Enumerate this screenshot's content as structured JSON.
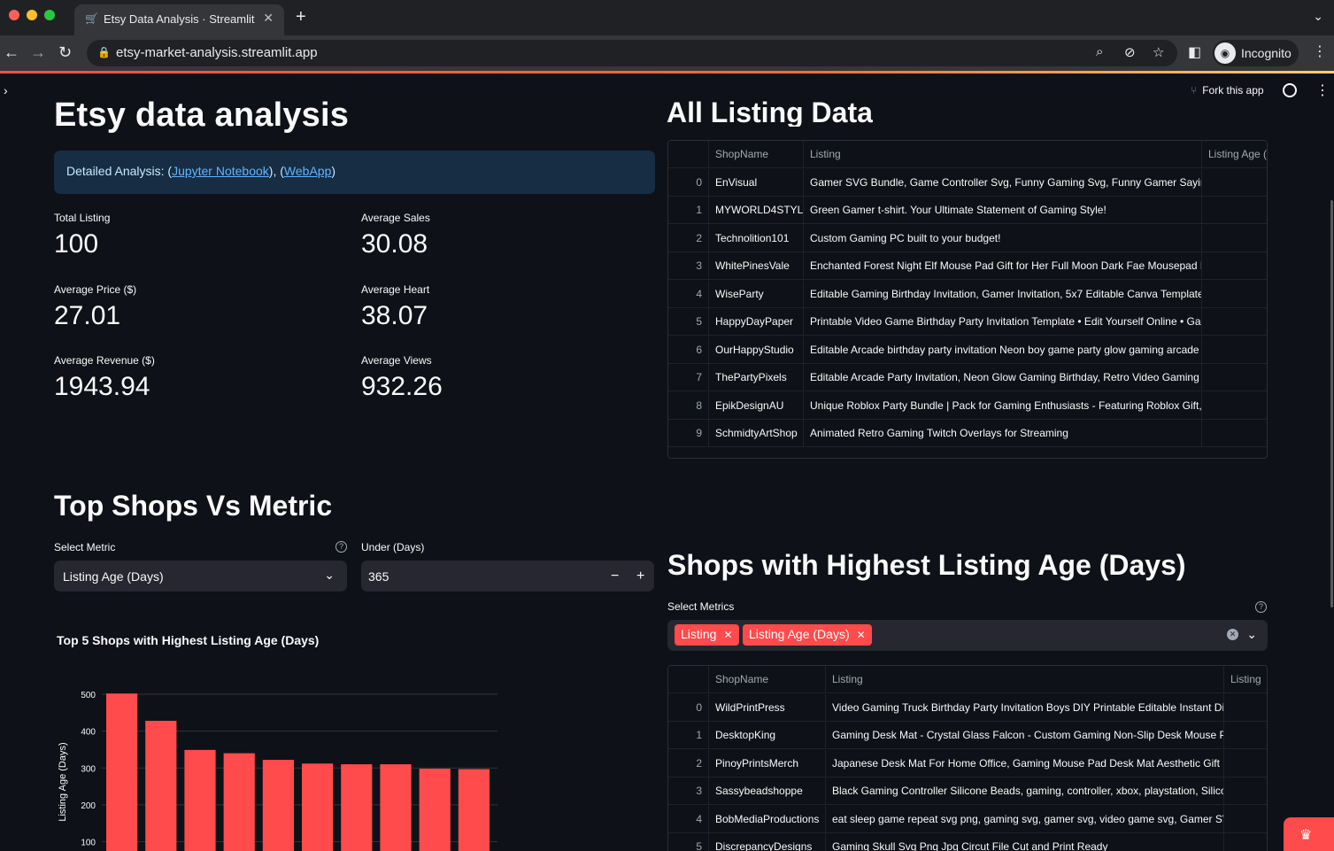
{
  "browser": {
    "tab_title": "Etsy Data Analysis · Streamlit",
    "url": "etsy-market-analysis.streamlit.app",
    "profile_label": "Incognito"
  },
  "header": {
    "fork_label": "Fork this app"
  },
  "page": {
    "title": "Etsy data analysis",
    "info": {
      "prefix": "Detailed Analysis: (",
      "link1": "Jupyter Notebook",
      "middle": "), (",
      "link2": "WebApp",
      "suffix": ")"
    }
  },
  "metrics": [
    {
      "label": "Total Listing",
      "value": "100"
    },
    {
      "label": "Average Sales",
      "value": "30.08"
    },
    {
      "label": "Average Price ($)",
      "value": "27.01"
    },
    {
      "label": "Average Heart",
      "value": "38.07"
    },
    {
      "label": "Average Revenue ($)",
      "value": "1943.94"
    },
    {
      "label": "Average Views",
      "value": "932.26"
    }
  ],
  "all_listing": {
    "heading": "All Listing Data",
    "columns": [
      "",
      "ShopName",
      "Listing",
      "Listing Age ("
    ],
    "rows": [
      [
        "0",
        "EnVisual",
        "Gamer SVG Bundle, Game Controller Svg, Funny Gaming Svg, Funny Gamer Sayings S"
      ],
      [
        "1",
        "MYWORLD4STYLE",
        "Green Gamer t-shirt. Your Ultimate Statement of Gaming Style!"
      ],
      [
        "2",
        "Technolition101",
        "Custom Gaming PC built to your budget!"
      ],
      [
        "3",
        "WhitePinesVale",
        "Enchanted Forest Night Elf Mouse Pad Gift for Her Full Moon Dark Fae Mousepad Drui"
      ],
      [
        "4",
        "WiseParty",
        "Editable Gaming Birthday Invitation, Gamer Invitation, 5x7 Editable Canva Template"
      ],
      [
        "5",
        "HappyDayPaper",
        "Printable Video Game Birthday Party Invitation Template • Edit Yourself Online • Game"
      ],
      [
        "6",
        "OurHappyStudio",
        "Editable Arcade birthday party invitation Neon boy game party glow gaming arcade b"
      ],
      [
        "7",
        "ThePartyPixels",
        "Editable Arcade Party Invitation, Neon Glow Gaming Birthday, Retro Video Gaming Ar"
      ],
      [
        "8",
        "EpikDesignAU",
        "Unique Roblox Party Bundle | Pack for Gaming Enthusiasts - Featuring Roblox Gift, Cli"
      ],
      [
        "9",
        "SchmidtyArtShop",
        "Animated Retro Gaming Twitch Overlays for Streaming"
      ]
    ]
  },
  "top_shops": {
    "heading": "Top Shops Vs Metric",
    "metric_label": "Select Metric",
    "metric_value": "Listing Age (Days)",
    "under_label": "Under (Days)",
    "under_value": "365",
    "minus": "−",
    "plus": "+"
  },
  "chart": {
    "title": "Top 5 Shops with Highest Listing Age (Days)",
    "color": "#ff4b4b"
  },
  "chart_data": {
    "type": "bar",
    "title": "Top 5 Shops with Highest Listing Age (Days)",
    "ylabel": "Listing Age (Days)",
    "xlabel": "",
    "yticks": [
      100,
      200,
      300,
      400,
      500
    ],
    "values": [
      502,
      428,
      349,
      340,
      322,
      312,
      310,
      310,
      298,
      297
    ],
    "ylim": [
      0,
      500
    ]
  },
  "highest_age": {
    "heading": "Shops with Highest Listing Age (Days)",
    "select_label": "Select Metrics",
    "tags": [
      "Listing",
      "Listing Age (Days)"
    ],
    "columns": [
      "",
      "ShopName",
      "Listing",
      "Listing"
    ],
    "rows": [
      [
        "0",
        "WildPrintPress",
        "Video Gaming Truck Birthday Party Invitation Boys DIY Printable Editable Instant Digi"
      ],
      [
        "1",
        "DesktopKing",
        "Gaming Desk Mat - Crystal Glass Falcon - Custom Gaming Non-Slip Desk Mouse Pad - /"
      ],
      [
        "2",
        "PinoyPrintsMerch",
        "Japanese Desk Mat For Home Office, Gaming Mouse Pad Desk Mat Aesthetic Gift For G"
      ],
      [
        "3",
        "Sassybeadshoppe",
        "Black Gaming Controller Silicone Beads, gaming, controller, xbox, playstation, Silicor"
      ],
      [
        "4",
        "BobMediaProductions",
        "eat sleep game repeat svg png, gaming svg, gamer svg, video game svg, Gamer SVG, g"
      ],
      [
        "5",
        "DiscrepancyDesigns",
        "Gaming Skull Svg Png Jpg Circut File Cut and Print Ready"
      ]
    ]
  }
}
